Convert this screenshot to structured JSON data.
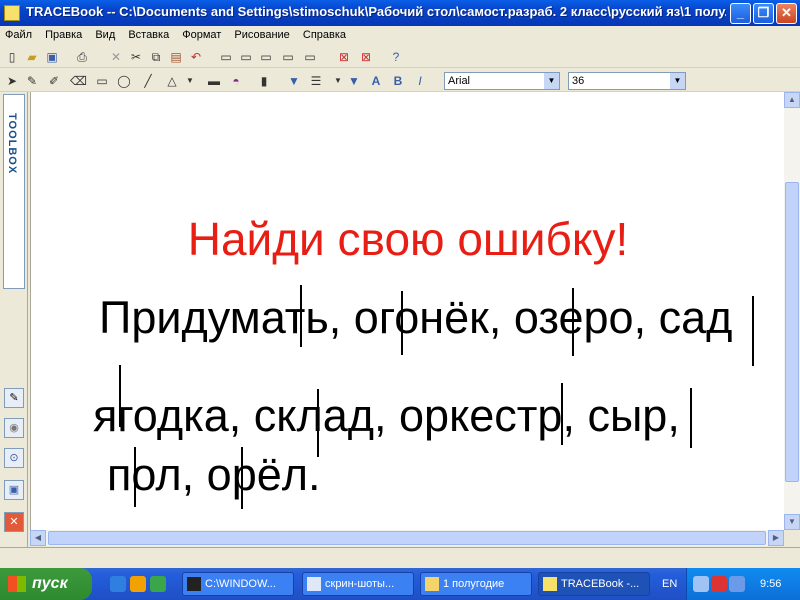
{
  "window": {
    "title": "TRACEBook -- C:\\Documents and Settings\\stimoschuk\\Рабочий стол\\самост.разраб. 2 класс\\русский яз\\1 полу...",
    "min_label": "_",
    "max_label": "❐",
    "close_label": "✕"
  },
  "menu": [
    "Файл",
    "Правка",
    "Вид",
    "Вставка",
    "Формат",
    "Рисование",
    "Справка"
  ],
  "toolbar": {
    "font_name": "Arial",
    "font_size": "36",
    "bold_label": "B",
    "italic_label": "I"
  },
  "toolbox": {
    "label": "TOOLBOX"
  },
  "slide": {
    "heading": "Найди свою ошибку!",
    "line1": "Придумать, огонёк, озеро, сад",
    "line2": "ягодка, склад,  оркестр, сыр,",
    "line3": "пол, орёл."
  },
  "colors": {
    "heading": "#e81e14",
    "text": "#000000",
    "canvas": "#ffffff",
    "titlebar": "#0842c7",
    "taskbar": "#245edb"
  },
  "taskbar": {
    "start_label": "пуск",
    "tasks": [
      {
        "label": "C:\\WINDOW...",
        "active": false
      },
      {
        "label": "скрин-шоты...",
        "active": false
      },
      {
        "label": "1 полугодие",
        "active": false
      },
      {
        "label": "TRACEBook -...",
        "active": true
      }
    ],
    "lang": "EN",
    "clock": "9:56"
  }
}
